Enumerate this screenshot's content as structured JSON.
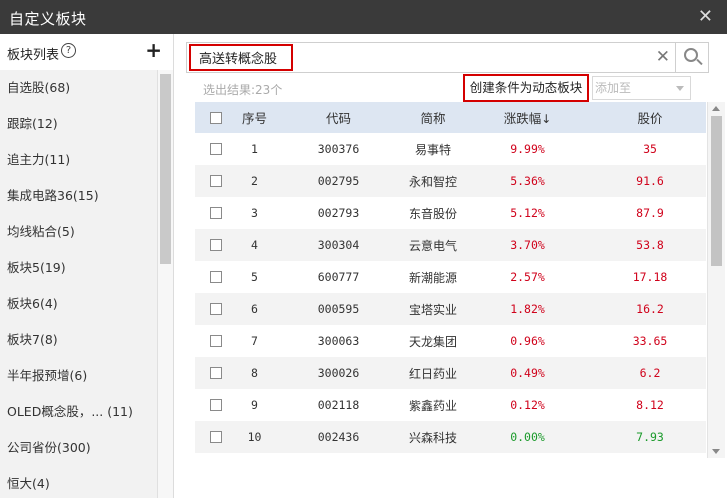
{
  "window": {
    "title": "自定义板块",
    "close_glyph": "✕"
  },
  "sidebar": {
    "header_label": "板块列表",
    "help_glyph": "?",
    "add_glyph": "+",
    "items": [
      {
        "label": "自选股(68)"
      },
      {
        "label": "跟踪(12)"
      },
      {
        "label": "追主力(11)"
      },
      {
        "label": "集成电路36(15)"
      },
      {
        "label": "均线粘合(5)"
      },
      {
        "label": "板块5(19)"
      },
      {
        "label": "板块6(4)"
      },
      {
        "label": "板块7(8)"
      },
      {
        "label": "半年报预增(6)"
      },
      {
        "label": "OLED概念股，... (11)"
      },
      {
        "label": "公司省份(300)"
      },
      {
        "label": "恒大(4)"
      }
    ]
  },
  "search": {
    "value": "高送转概念股",
    "clear_glyph": "✕"
  },
  "toolbar": {
    "result_count": "选出结果:23个",
    "create_button": "创建条件为动态板块",
    "add_to_select": "添加至"
  },
  "table": {
    "headers": {
      "seq": "序号",
      "code": "代码",
      "name": "简称",
      "change": "涨跌幅",
      "change_sort": "↓",
      "price": "股价"
    },
    "rows": [
      {
        "seq": "1",
        "code": "300376",
        "name": "易事特",
        "change": "9.99%",
        "price": "35",
        "trend": "up"
      },
      {
        "seq": "2",
        "code": "002795",
        "name": "永和智控",
        "change": "5.36%",
        "price": "91.6",
        "trend": "up"
      },
      {
        "seq": "3",
        "code": "002793",
        "name": "东音股份",
        "change": "5.12%",
        "price": "87.9",
        "trend": "up"
      },
      {
        "seq": "4",
        "code": "300304",
        "name": "云意电气",
        "change": "3.70%",
        "price": "53.8",
        "trend": "up"
      },
      {
        "seq": "5",
        "code": "600777",
        "name": "新潮能源",
        "change": "2.57%",
        "price": "17.18",
        "trend": "up"
      },
      {
        "seq": "6",
        "code": "000595",
        "name": "宝塔实业",
        "change": "1.82%",
        "price": "16.2",
        "trend": "up"
      },
      {
        "seq": "7",
        "code": "300063",
        "name": "天龙集团",
        "change": "0.96%",
        "price": "33.65",
        "trend": "up"
      },
      {
        "seq": "8",
        "code": "300026",
        "name": "红日药业",
        "change": "0.49%",
        "price": "6.2",
        "trend": "up"
      },
      {
        "seq": "9",
        "code": "002118",
        "name": "紫鑫药业",
        "change": "0.12%",
        "price": "8.12",
        "trend": "up"
      },
      {
        "seq": "10",
        "code": "002436",
        "name": "兴森科技",
        "change": "0.00%",
        "price": "7.93",
        "trend": "flat"
      }
    ]
  },
  "colors": {
    "up": "#d0021b",
    "flat": "#1a9a2a",
    "highlight_border": "#d40000",
    "header_bg": "#dde6f2"
  }
}
